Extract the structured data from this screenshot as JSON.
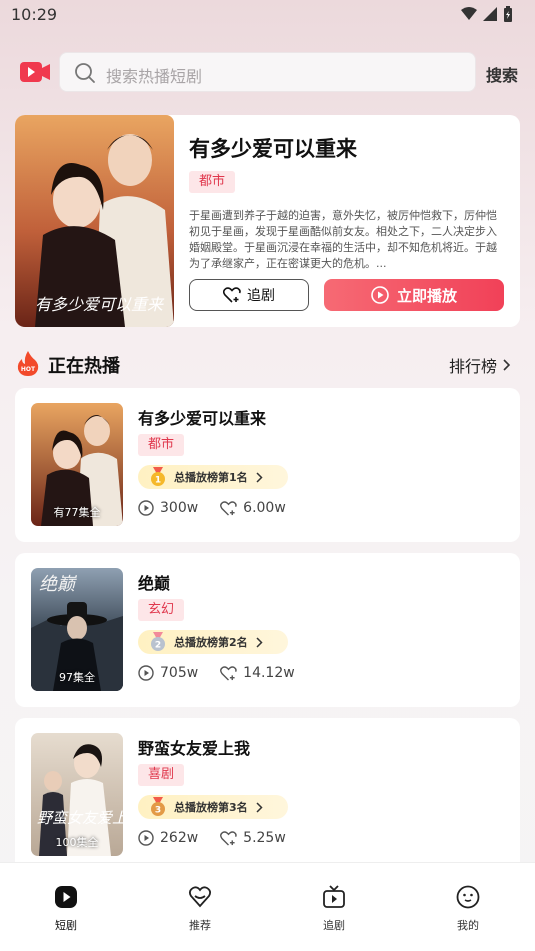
{
  "status_bar": {
    "time": "10:29"
  },
  "search": {
    "placeholder": "搜索热播短剧",
    "button_label": "搜索"
  },
  "featured": {
    "title": "有多少爱可以重来",
    "tag": "都市",
    "description": "于星画遭到养子于越的迫害，意外失忆，被厉仲恺救下，厉仲恺初见于星画，发现于星画酷似前女友。相处之下，二人决定步入婚姻殿堂。于星画沉浸在幸福的生活中，却不知危机将近。于越为了承继家产，正在密谋更大的危机。...",
    "follow_label": "追剧",
    "play_label": "立即播放",
    "poster_title": "有多少爱可以重来"
  },
  "section": {
    "title": "正在热播",
    "ranking_label": "排行榜"
  },
  "dramas": [
    {
      "title": "有多少爱可以重来",
      "tag": "都市",
      "rank_label": "总播放榜第1名",
      "rank_number": "1",
      "plays": "300w",
      "likes": "6.00w",
      "episodes": "有77集全"
    },
    {
      "title": "绝巅",
      "tag": "玄幻",
      "rank_label": "总播放榜第2名",
      "rank_number": "2",
      "plays": "705w",
      "likes": "14.12w",
      "episodes": "97集全"
    },
    {
      "title": "野蛮女友爱上我",
      "tag": "喜剧",
      "rank_label": "总播放榜第3名",
      "rank_number": "3",
      "plays": "262w",
      "likes": "5.25w",
      "episodes": "100集全",
      "poster_title": "野蛮女友爱上我"
    }
  ],
  "bottom_nav": [
    {
      "label": "短剧",
      "icon": "play-icon"
    },
    {
      "label": "推荐",
      "icon": "recommend-icon"
    },
    {
      "label": "追剧",
      "icon": "tv-icon"
    },
    {
      "label": "我的",
      "icon": "profile-icon"
    }
  ],
  "colors": {
    "accent": "#f14158",
    "tag_bg": "#fde6e8",
    "tag_text": "#e0384d",
    "rank_badge": "#fff1c2"
  }
}
